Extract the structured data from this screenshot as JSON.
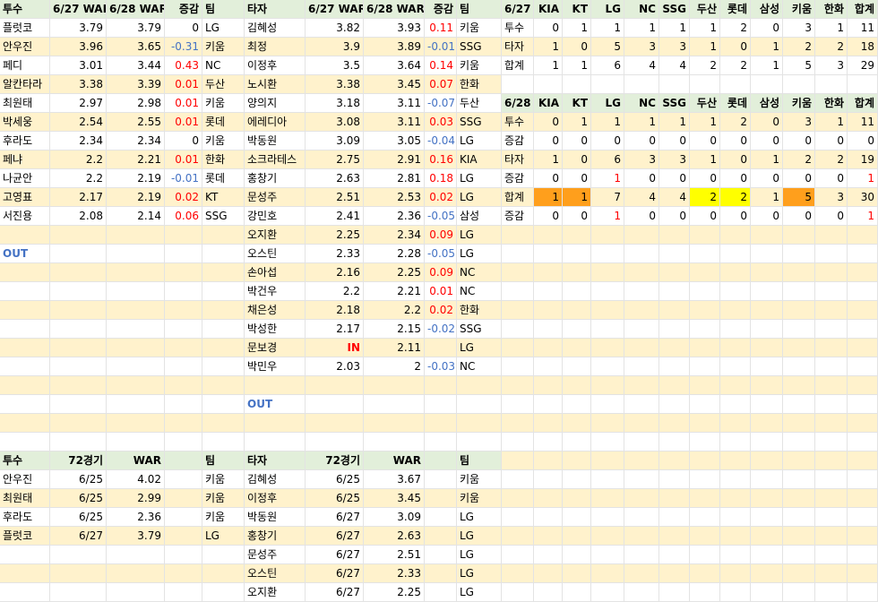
{
  "rows": [
    [
      "투수",
      "6/27 WAR",
      "6/28 WAR",
      "증감",
      "팀",
      "타자",
      "6/27 WAR",
      "6/28 WAR",
      "증감",
      "팀",
      "6/27",
      "KIA",
      "KT",
      "LG",
      "NC",
      "SSG",
      "두산",
      "롯데",
      "삼성",
      "키움",
      "한화",
      "합계"
    ],
    [
      "플럿코",
      "3.79",
      "3.79",
      "0",
      "LG",
      "김혜성",
      "3.82",
      "3.93",
      "0.11",
      "키움",
      "투수",
      "0",
      "1",
      "1",
      "1",
      "1",
      "1",
      "2",
      "0",
      "3",
      "1",
      "11"
    ],
    [
      "안우진",
      "3.96",
      "3.65",
      "-0.31",
      "키움",
      "최정",
      "3.9",
      "3.89",
      "-0.01",
      "SSG",
      "타자",
      "1",
      "0",
      "5",
      "3",
      "3",
      "1",
      "0",
      "1",
      "2",
      "2",
      "18"
    ],
    [
      "페디",
      "3.01",
      "3.44",
      "0.43",
      "NC",
      "이정후",
      "3.5",
      "3.64",
      "0.14",
      "키움",
      "합계",
      "1",
      "1",
      "6",
      "4",
      "4",
      "2",
      "2",
      "1",
      "5",
      "3",
      "29"
    ],
    [
      "알칸타라",
      "3.38",
      "3.39",
      "0.01",
      "두산",
      "노시환",
      "3.38",
      "3.45",
      "0.07",
      "한화",
      "",
      "",
      "",
      "",
      "",
      "",
      "",
      "",
      "",
      "",
      "",
      ""
    ],
    [
      "최원태",
      "2.97",
      "2.98",
      "0.01",
      "키움",
      "양의지",
      "3.18",
      "3.11",
      "-0.07",
      "두산",
      "6/28",
      "KIA",
      "KT",
      "LG",
      "NC",
      "SSG",
      "두산",
      "롯데",
      "삼성",
      "키움",
      "한화",
      "합계"
    ],
    [
      "박세웅",
      "2.54",
      "2.55",
      "0.01",
      "롯데",
      "에레디아",
      "3.08",
      "3.11",
      "0.03",
      "SSG",
      "투수",
      "0",
      "1",
      "1",
      "1",
      "1",
      "1",
      "2",
      "0",
      "3",
      "1",
      "11"
    ],
    [
      "후라도",
      "2.34",
      "2.34",
      "0",
      "키움",
      "박동원",
      "3.09",
      "3.05",
      "-0.04",
      "LG",
      "증감",
      "0",
      "0",
      "0",
      "0",
      "0",
      "0",
      "0",
      "0",
      "0",
      "0",
      "0"
    ],
    [
      "페냐",
      "2.2",
      "2.21",
      "0.01",
      "한화",
      "소크라테스",
      "2.75",
      "2.91",
      "0.16",
      "KIA",
      "타자",
      "1",
      "0",
      "6",
      "3",
      "3",
      "1",
      "0",
      "1",
      "2",
      "2",
      "19"
    ],
    [
      "나균안",
      "2.2",
      "2.19",
      "-0.01",
      "롯데",
      "홍창기",
      "2.63",
      "2.81",
      "0.18",
      "LG",
      "증감",
      "0",
      "0",
      "1",
      "0",
      "0",
      "0",
      "0",
      "0",
      "0",
      "0",
      "1"
    ],
    [
      "고영표",
      "2.17",
      "2.19",
      "0.02",
      "KT",
      "문성주",
      "2.51",
      "2.53",
      "0.02",
      "LG",
      "합계",
      "1",
      "1",
      "7",
      "4",
      "4",
      "2",
      "2",
      "1",
      "5",
      "3",
      "30"
    ],
    [
      "서진용",
      "2.08",
      "2.14",
      "0.06",
      "SSG",
      "강민호",
      "2.41",
      "2.36",
      "-0.05",
      "삼성",
      "증감",
      "0",
      "0",
      "1",
      "0",
      "0",
      "0",
      "0",
      "0",
      "0",
      "0",
      "1"
    ],
    [
      "",
      "",
      "",
      "",
      "",
      "오지환",
      "2.25",
      "2.34",
      "0.09",
      "LG",
      "",
      "",
      "",
      "",
      "",
      "",
      "",
      "",
      "",
      "",
      "",
      ""
    ],
    [
      "OUT",
      "",
      "",
      "",
      "",
      "오스틴",
      "2.33",
      "2.28",
      "-0.05",
      "LG",
      "",
      "",
      "",
      "",
      "",
      "",
      "",
      "",
      "",
      "",
      "",
      ""
    ],
    [
      "",
      "",
      "",
      "",
      "",
      "손아섭",
      "2.16",
      "2.25",
      "0.09",
      "NC",
      "",
      "",
      "",
      "",
      "",
      "",
      "",
      "",
      "",
      "",
      "",
      ""
    ],
    [
      "",
      "",
      "",
      "",
      "",
      "박건우",
      "2.2",
      "2.21",
      "0.01",
      "NC",
      "",
      "",
      "",
      "",
      "",
      "",
      "",
      "",
      "",
      "",
      "",
      ""
    ],
    [
      "",
      "",
      "",
      "",
      "",
      "채은성",
      "2.18",
      "2.2",
      "0.02",
      "한화",
      "",
      "",
      "",
      "",
      "",
      "",
      "",
      "",
      "",
      "",
      "",
      ""
    ],
    [
      "",
      "",
      "",
      "",
      "",
      "박성한",
      "2.17",
      "2.15",
      "-0.02",
      "SSG",
      "",
      "",
      "",
      "",
      "",
      "",
      "",
      "",
      "",
      "",
      "",
      ""
    ],
    [
      "",
      "",
      "",
      "",
      "",
      "문보경",
      "IN",
      "2.11",
      "",
      "LG",
      "",
      "",
      "",
      "",
      "",
      "",
      "",
      "",
      "",
      "",
      "",
      ""
    ],
    [
      "",
      "",
      "",
      "",
      "",
      "박민우",
      "2.03",
      "2",
      "-0.03",
      "NC",
      "",
      "",
      "",
      "",
      "",
      "",
      "",
      "",
      "",
      "",
      "",
      ""
    ],
    [
      "",
      "",
      "",
      "",
      "",
      "",
      "",
      "",
      "",
      "",
      "",
      "",
      "",
      "",
      "",
      "",
      "",
      "",
      "",
      "",
      "",
      ""
    ],
    [
      "",
      "",
      "",
      "",
      "",
      "OUT",
      "",
      "",
      "",
      "",
      "",
      "",
      "",
      "",
      "",
      "",
      "",
      "",
      "",
      "",
      "",
      ""
    ],
    [
      "",
      "",
      "",
      "",
      "",
      "",
      "",
      "",
      "",
      "",
      "",
      "",
      "",
      "",
      "",
      "",
      "",
      "",
      "",
      "",
      "",
      ""
    ],
    [
      "",
      "",
      "",
      "",
      "",
      "",
      "",
      "",
      "",
      "",
      "",
      "",
      "",
      "",
      "",
      "",
      "",
      "",
      "",
      "",
      "",
      ""
    ],
    [
      "투수",
      "72경기",
      "WAR",
      "",
      "팀",
      "타자",
      "72경기",
      "WAR",
      "",
      "팀",
      "",
      "",
      "",
      "",
      "",
      "",
      "",
      "",
      "",
      "",
      "",
      ""
    ],
    [
      "안우진",
      "6/25",
      "4.02",
      "",
      "키움",
      "김혜성",
      "6/25",
      "3.67",
      "",
      "키움",
      "",
      "",
      "",
      "",
      "",
      "",
      "",
      "",
      "",
      "",
      "",
      ""
    ],
    [
      "최원태",
      "6/25",
      "2.99",
      "",
      "키움",
      "이정후",
      "6/25",
      "3.45",
      "",
      "키움",
      "",
      "",
      "",
      "",
      "",
      "",
      "",
      "",
      "",
      "",
      "",
      ""
    ],
    [
      "후라도",
      "6/25",
      "2.36",
      "",
      "키움",
      "박동원",
      "6/27",
      "3.09",
      "",
      "LG",
      "",
      "",
      "",
      "",
      "",
      "",
      "",
      "",
      "",
      "",
      "",
      ""
    ],
    [
      "플럿코",
      "6/27",
      "3.79",
      "",
      "LG",
      "홍창기",
      "6/27",
      "2.63",
      "",
      "LG",
      "",
      "",
      "",
      "",
      "",
      "",
      "",
      "",
      "",
      "",
      "",
      ""
    ],
    [
      "",
      "",
      "",
      "",
      "",
      "문성주",
      "6/27",
      "2.51",
      "",
      "LG",
      "",
      "",
      "",
      "",
      "",
      "",
      "",
      "",
      "",
      "",
      "",
      ""
    ],
    [
      "",
      "",
      "",
      "",
      "",
      "오스틴",
      "6/27",
      "2.33",
      "",
      "LG",
      "",
      "",
      "",
      "",
      "",
      "",
      "",
      "",
      "",
      "",
      "",
      ""
    ],
    [
      "",
      "",
      "",
      "",
      "",
      "오지환",
      "6/27",
      "2.25",
      "",
      "LG",
      "",
      "",
      "",
      "",
      "",
      "",
      "",
      "",
      "",
      "",
      "",
      ""
    ]
  ],
  "colors": {
    "header_green": "#e2efda",
    "cream": "#fff2cc",
    "negative_blue": "#4472c4",
    "positive_red": "#ff0000",
    "highlight_orange": "#ff9f1c",
    "highlight_yellow": "#ffff00"
  }
}
